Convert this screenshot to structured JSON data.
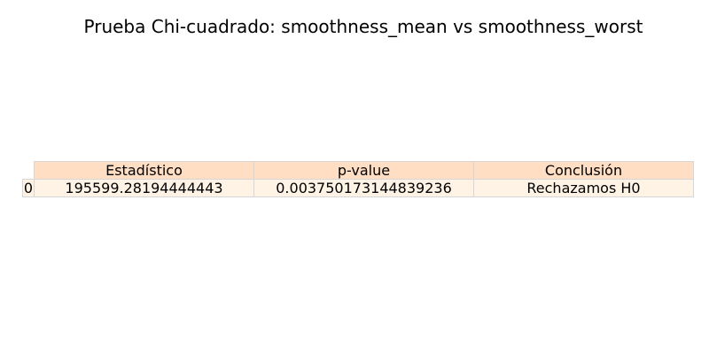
{
  "chart_data": {
    "type": "table",
    "title": "Prueba Chi-cuadrado: smoothness_mean vs smoothness_worst",
    "columns": [
      "Estadístico",
      "p-value",
      "Conclusión"
    ],
    "rows": [
      {
        "index": "0",
        "cells": [
          "195599.28194444443",
          "0.003750173144839236",
          "Rechazamos H0"
        ]
      }
    ]
  },
  "colors": {
    "header_fill": "#ffdec4",
    "row_fill": "#fff3e6",
    "grid_line": "#d6d6d6"
  }
}
